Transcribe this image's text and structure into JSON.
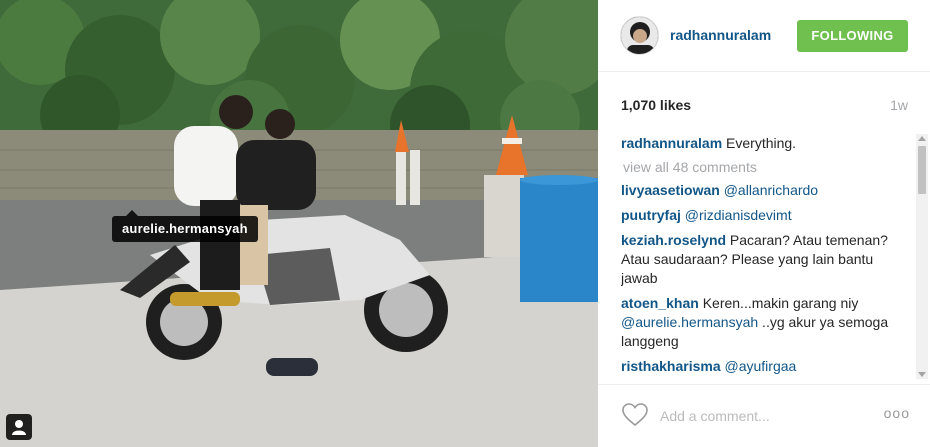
{
  "photo": {
    "tag_label": "aurelie.hermansyah",
    "user_badge_icon": "user-silhouette-icon"
  },
  "header": {
    "username": "radhannuralam",
    "follow_label": "FOLLOWING",
    "follow_color": "#70c050"
  },
  "stats": {
    "likes": "1,070 likes",
    "age": "1w"
  },
  "caption": {
    "author": "radhannuralam",
    "text": " Everything."
  },
  "view_all": "view all 48 comments",
  "comments": [
    {
      "author": "livyaasetiowan",
      "text": " @allanrichardo"
    },
    {
      "author": "puutryfaj",
      "text": " @rizdianisdevimt"
    },
    {
      "author": "keziah.roselynd",
      "text": " Pacaran? Atau temenan? Atau saudaraan? Please yang lain bantu jawab"
    },
    {
      "author": "atoen_khan",
      "text": " Keren...makin garang niy @aurelie.hermansyah ..yg akur ya semoga langgeng"
    },
    {
      "author": "risthakharisma",
      "text": " @ayufirgaa"
    }
  ],
  "footer": {
    "heart_icon": "heart-outline-icon",
    "comment_placeholder": "Add a comment...",
    "more_label": "ooo"
  },
  "colors": {
    "link": "#125688",
    "muted": "#a5a7aa"
  }
}
